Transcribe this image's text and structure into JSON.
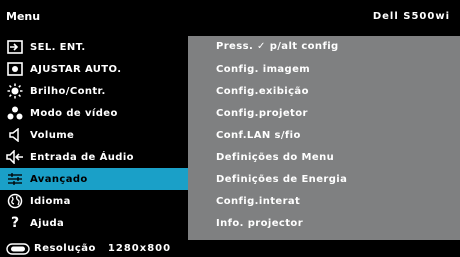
{
  "header": {
    "title": "Menu",
    "model": "Dell S500wi"
  },
  "menu": {
    "items": [
      {
        "label": "SEL. ENT.",
        "icon": "input-source-icon"
      },
      {
        "label": "AJUSTAR AUTO.",
        "icon": "auto-adjust-icon"
      },
      {
        "label": "Brilho/Contr.",
        "icon": "brightness-icon"
      },
      {
        "label": "Modo de vídeo",
        "icon": "video-mode-icon"
      },
      {
        "label": "Volume",
        "icon": "speaker-icon"
      },
      {
        "label": "Entrada de Áudio",
        "icon": "audio-input-icon"
      },
      {
        "label": "Avançado",
        "icon": "advanced-settings-icon"
      },
      {
        "label": "Idioma",
        "icon": "language-icon"
      },
      {
        "label": "Ajuda",
        "icon": "help-icon"
      }
    ],
    "selected": "Avançado"
  },
  "submenu": {
    "items": [
      {
        "label": "Press. ✓ p/alt config"
      },
      {
        "label": "Config. imagem"
      },
      {
        "label": "Config.exibição"
      },
      {
        "label": "Config.projetor"
      },
      {
        "label": "Conf.LAN s/fio"
      },
      {
        "label": "Definições do Menu"
      },
      {
        "label": "Definições de Energia"
      },
      {
        "label": "Config.interat"
      },
      {
        "label": "Info. projector"
      }
    ]
  },
  "footer": {
    "label": "Resolução",
    "value": "1280x800",
    "icon": "resolution-icon"
  },
  "colors": {
    "highlight": "#1aa0c8",
    "panel": "#7f8081"
  }
}
